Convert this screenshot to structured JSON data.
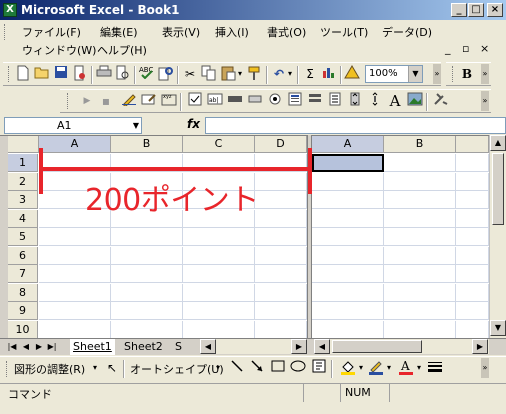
{
  "window": {
    "title": "Microsoft Excel - Book1",
    "app_icon": "X"
  },
  "caption_buttons": {
    "minimize": "_",
    "restore": "□",
    "close": "×"
  },
  "menu": {
    "items": [
      "ファイル(F)",
      "編集(E)",
      "表示(V)",
      "挿入(I)",
      "書式(O)",
      "ツール(T)",
      "データ(D)"
    ],
    "items_row2": [
      "ウィンドウ(W)",
      "ヘルプ(H)"
    ],
    "mdi_minimize": "_",
    "mdi_restore": "▫",
    "mdi_close": "×"
  },
  "toolbar": {
    "zoom": "100%",
    "bold": "B"
  },
  "formula_bar": {
    "name_box": "A1",
    "fx": "fx",
    "formula": ""
  },
  "grid": {
    "left_columns": [
      "A",
      "B",
      "C",
      "D"
    ],
    "right_columns": [
      "A",
      "B"
    ],
    "rows": [
      "1",
      "2",
      "3",
      "4",
      "5",
      "6",
      "7",
      "8",
      "9",
      "10"
    ]
  },
  "sheet_tabs": {
    "tabs": [
      "Sheet1",
      "Sheet2",
      "S"
    ],
    "active": "Sheet1"
  },
  "drawing_toolbar": {
    "draw_menu": "図形の調整(R)",
    "autoshapes_menu": "オートシェイプ(U)"
  },
  "status_bar": {
    "mode": "コマンド",
    "num": "NUM"
  },
  "annotation": {
    "text": "200ポイント",
    "color": "#e8252b"
  }
}
